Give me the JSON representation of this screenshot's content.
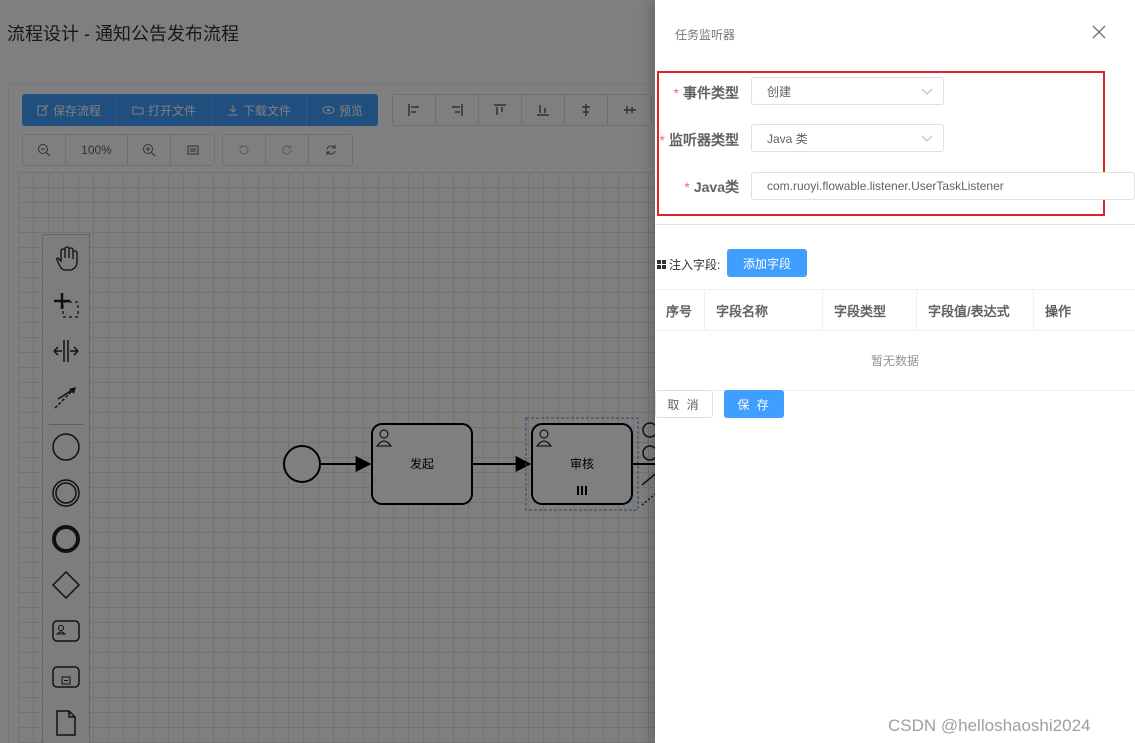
{
  "page": {
    "title": "流程设计 - 通知公告发布流程"
  },
  "toolbar": {
    "save_label": "保存流程",
    "open_label": "打开文件",
    "download_label": "下载文件",
    "preview_label": "预览",
    "zoom_level": "100%"
  },
  "diagram": {
    "tasks": [
      {
        "label": "发起"
      },
      {
        "label": "审核"
      }
    ]
  },
  "drawer": {
    "title": "任务监听器",
    "event_type": {
      "label": "事件类型",
      "value": "创建"
    },
    "listener_type": {
      "label": "监听器类型",
      "value": "Java 类"
    },
    "java_class": {
      "label": "Java类",
      "value": "com.ruoyi.flowable.listener.UserTaskListener"
    },
    "inject_label": "注入字段:",
    "add_field_label": "添加字段",
    "table": {
      "columns": [
        "序号",
        "字段名称",
        "字段类型",
        "字段值/表达式",
        "操作"
      ],
      "empty_text": "暂无数据"
    },
    "cancel_label": "取 消",
    "save_label": "保 存"
  },
  "watermark": "CSDN @helloshaoshi2024",
  "colors": {
    "primary": "#409eff",
    "required": "#f56c6c",
    "highlight": "#e02424"
  }
}
